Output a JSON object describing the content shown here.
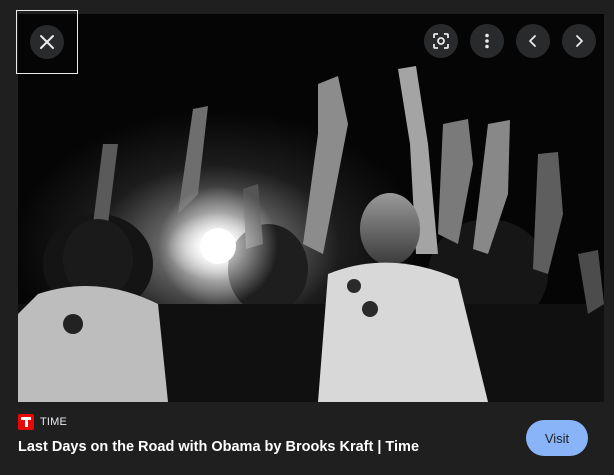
{
  "image_alt": "Black and white photograph of a crowd raising their hands at a rally, bright stage light in background",
  "toolbar": {
    "close_icon": "close-icon",
    "icons": [
      "lens-search-icon",
      "more-vert-icon",
      "chevron-left-icon",
      "chevron-right-icon"
    ]
  },
  "result": {
    "source_name": "TIME",
    "title": "Last Days on the Road with Obama by Brooks Kraft | Time",
    "visit_label": "Visit"
  },
  "colors": {
    "background": "#1f1f1f",
    "accent": "#8ab4f8",
    "favicon": "#e90606"
  }
}
